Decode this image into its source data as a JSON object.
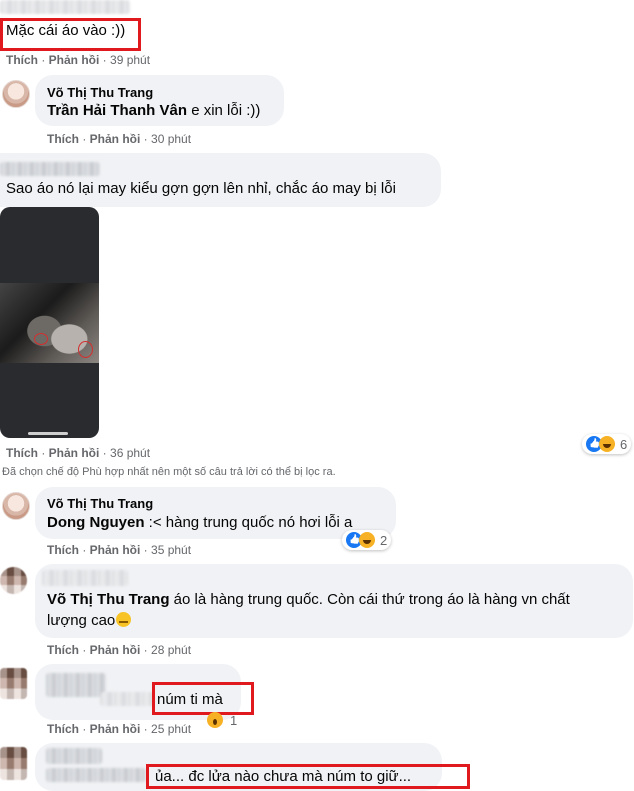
{
  "actions": {
    "like": "Thích",
    "reply": "Phản hồi"
  },
  "comments": [
    {
      "text": "Mặc cái áo vào :))",
      "time": "39 phút"
    },
    {
      "author": "Võ Thị Thu Trang",
      "mention": "Trần Hải Thanh Vân",
      "text": " e xin lỗi :))",
      "time": "30 phút"
    },
    {
      "text": "Sao áo nó lại may kiểu gợn gợn lên nhỉ, chắc áo may bị lỗi",
      "time": "36 phút",
      "reaction_count": "6"
    },
    {
      "author": "Võ Thị Thu Trang",
      "mention": "Dong Nguyen",
      "text": " :< hàng trung quốc nó hơi lỗi a",
      "time": "35 phút",
      "reaction_count": "2"
    },
    {
      "mention": "Võ Thị Thu Trang",
      "text": " áo là hàng trung quốc. Còn cái thứ trong áo là hàng vn chất",
      "text_line2": "lượng cao",
      "time": "28 phút"
    },
    {
      "text": "núm ti mà",
      "time": "25 phút",
      "reaction_count": "1"
    },
    {
      "text": "ủa... đc lửa nào chưa mà núm to giữ..."
    }
  ],
  "filter_notice": "Đã chọn chế độ Phù hợp nhất nên một số câu trả lời có thể bị lọc ra.",
  "colors": {
    "highlight": "#e0191f",
    "bubble": "#f0f2f5",
    "meta": "#65676b"
  }
}
